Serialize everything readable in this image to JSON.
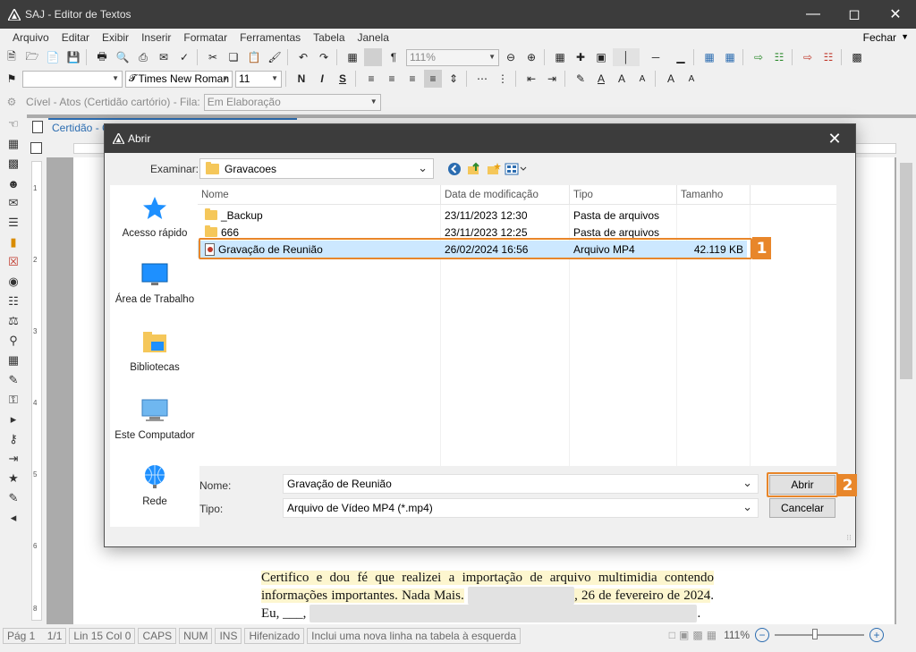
{
  "window": {
    "title": "SAJ - Editor de Textos"
  },
  "menu": {
    "items": [
      "Arquivo",
      "Editar",
      "Exibir",
      "Inserir",
      "Formatar",
      "Ferramentas",
      "Tabela",
      "Janela"
    ],
    "close_label": "Fechar"
  },
  "toolbar": {
    "zoom": "111%",
    "font_name": "Times New Roman",
    "font_size": "11",
    "bold": "N",
    "italic": "I",
    "strike": "S",
    "text_color": "A",
    "font_grow": "A",
    "font_shrink": "A",
    "case_upper": "A",
    "case_lower": "A",
    "pilcrow": "¶"
  },
  "workflow_bar": {
    "label": "Cível - Atos (Certidão cartório) - Fila:",
    "status": "Em Elaboração"
  },
  "document": {
    "tab_title": "Certidão - C",
    "text_part1": "Certifico e dou fé que realizei a importação de arquivo multimidia contendo informações importantes. Nada Mais.",
    "text_part2": ", 26 de fevereiro de 2024",
    "text_part3": ". Eu, ___,"
  },
  "dialog": {
    "title": "Abrir",
    "look_in_label": "Examinar:",
    "look_in_value": "Gravacoes",
    "places": [
      "Acesso rápido",
      "Área de Trabalho",
      "Bibliotecas",
      "Este Computador",
      "Rede"
    ],
    "columns": [
      "Nome",
      "Data de modificação",
      "Tipo",
      "Tamanho"
    ],
    "files": [
      {
        "name": "_Backup",
        "date": "23/11/2023 12:30",
        "type": "Pasta de arquivos",
        "size": ""
      },
      {
        "name": "666",
        "date": "23/11/2023 12:25",
        "type": "Pasta de arquivos",
        "size": ""
      },
      {
        "name": "Gravação de Reunião",
        "date": "26/02/2024 16:56",
        "type": "Arquivo MP4",
        "size": "42.119 KB"
      }
    ],
    "filename_label": "Nome:",
    "filename_value": "Gravação de Reunião",
    "filetype_label": "Tipo:",
    "filetype_value": "Arquivo de Vídeo MP4 (*.mp4)",
    "open_button": "Abrir",
    "cancel_button": "Cancelar"
  },
  "callouts": {
    "step1": "1",
    "step2": "2"
  },
  "status_bar": {
    "page": "Pág 1",
    "page_of": "1/1",
    "position": "Lin 15 Col 0",
    "caps": "CAPS",
    "num": "NUM",
    "ins": "INS",
    "hyphen": "Hifenizado",
    "hint": "Inclui uma nova linha na tabela à esquerda",
    "zoom": "111%"
  },
  "colors": {
    "accent": "#2b6cb0",
    "callout": "#e8862a",
    "selection": "#cce8ff",
    "titlebar": "#3c3c3c"
  }
}
